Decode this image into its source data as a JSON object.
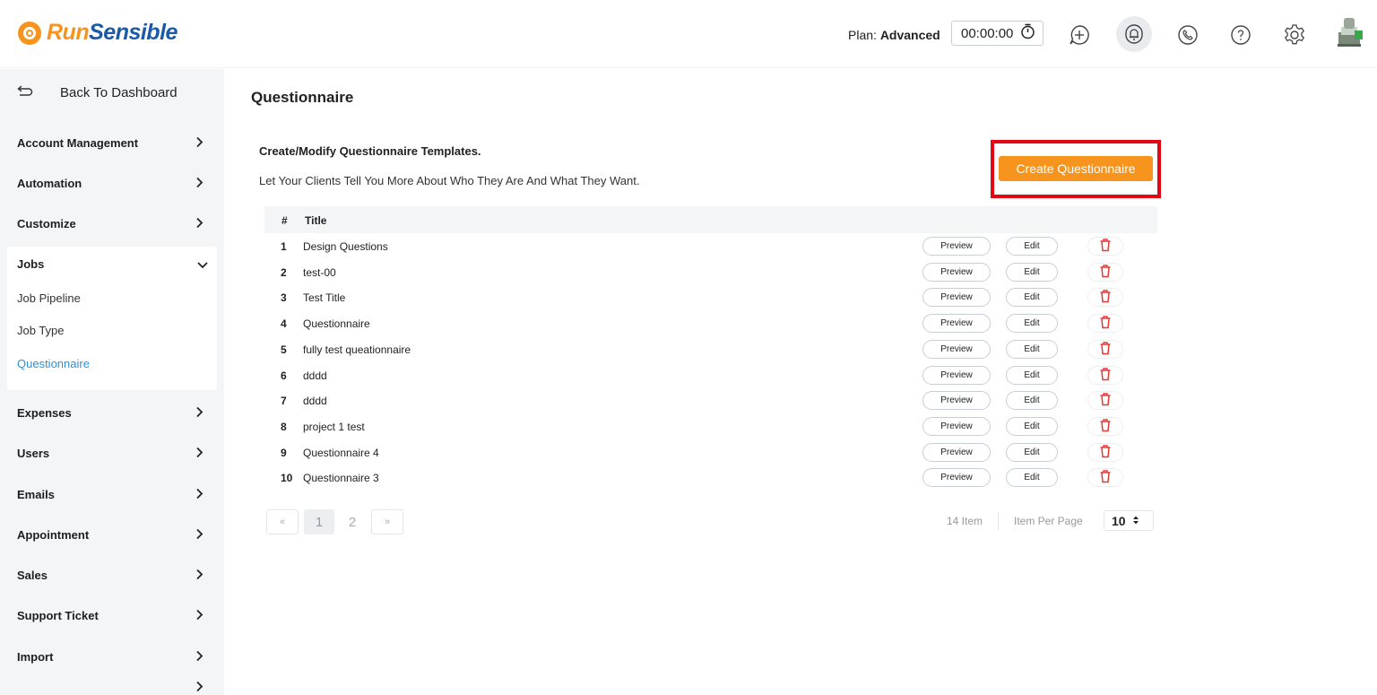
{
  "brand": {
    "name_part1": "Run",
    "name_part2": "Sensible"
  },
  "header": {
    "plan_label": "Plan:",
    "plan_value": "Advanced",
    "timer": "00:00:00",
    "icons": [
      "add-icon",
      "bell-icon",
      "phone-icon",
      "help-icon",
      "gear-icon",
      "user-avatar"
    ]
  },
  "sidebar": {
    "back_label": "Back To Dashboard",
    "items_before": [
      {
        "label": "Account Management"
      },
      {
        "label": "Automation"
      },
      {
        "label": "Customize"
      }
    ],
    "jobs": {
      "label": "Jobs",
      "children": [
        {
          "label": "Job Pipeline"
        },
        {
          "label": "Job Type"
        },
        {
          "label": "Questionnaire"
        }
      ]
    },
    "items_after": [
      {
        "label": "Expenses"
      },
      {
        "label": "Users"
      },
      {
        "label": "Emails"
      },
      {
        "label": "Appointment"
      },
      {
        "label": "Sales"
      },
      {
        "label": "Support Ticket"
      },
      {
        "label": "Import"
      }
    ]
  },
  "main": {
    "title": "Questionnaire",
    "desc_heading": "Create/Modify Questionnaire Templates.",
    "desc_text": "Let Your Clients Tell You More About Who They Are And What They Want.",
    "create_label": "Create Questionnaire",
    "table": {
      "col_num": "#",
      "col_title": "Title",
      "preview_label": "Preview",
      "edit_label": "Edit",
      "rows": [
        {
          "num": "1",
          "title": "Design Questions"
        },
        {
          "num": "2",
          "title": "test-00"
        },
        {
          "num": "3",
          "title": "Test Title"
        },
        {
          "num": "4",
          "title": "Questionnaire"
        },
        {
          "num": "5",
          "title": "fully test queationnaire"
        },
        {
          "num": "6",
          "title": "dddd"
        },
        {
          "num": "7",
          "title": "dddd"
        },
        {
          "num": "8",
          "title": "project 1 test"
        },
        {
          "num": "9",
          "title": "Questionnaire 4"
        },
        {
          "num": "10",
          "title": "Questionnaire 3"
        }
      ]
    },
    "pagination": {
      "prev": "«",
      "pages": [
        "1",
        "2"
      ],
      "current_page": "1",
      "next": "»",
      "item_count": "14 Item",
      "per_page_label": "Item Per Page",
      "per_page_value": "10"
    }
  },
  "colors": {
    "accent": "#f7941d",
    "brand_blue": "#1a5aa6",
    "highlight": "#e30613",
    "link": "#2f8fd6",
    "delete": "#e53935"
  }
}
